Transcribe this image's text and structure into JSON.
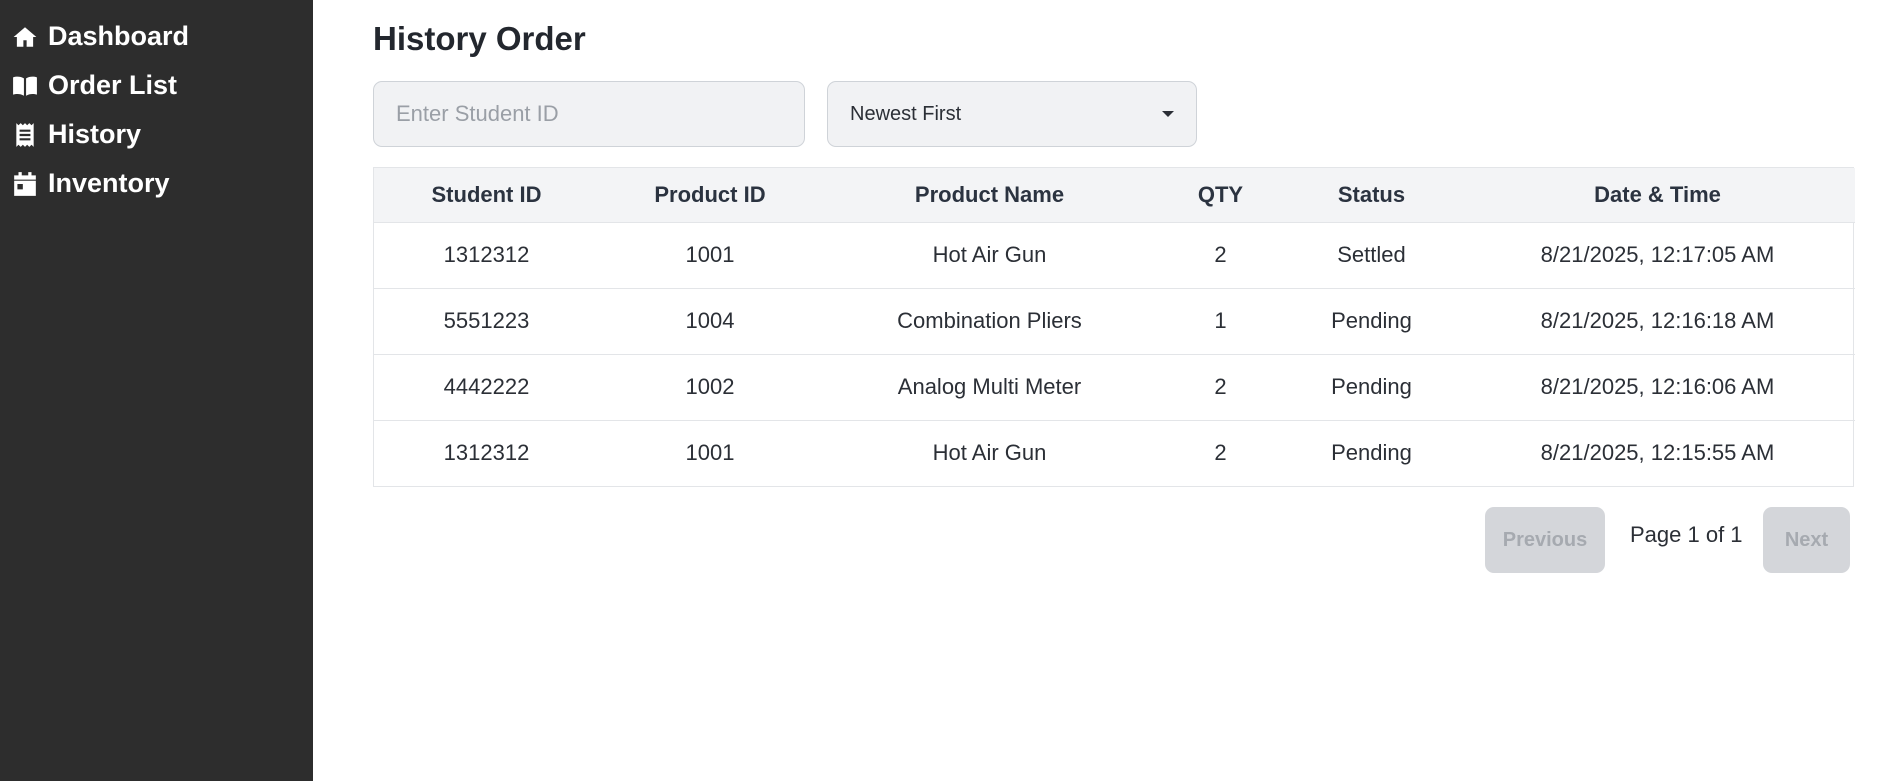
{
  "sidebar": {
    "items": [
      {
        "label": "Dashboard",
        "icon": "home-icon"
      },
      {
        "label": "Order List",
        "icon": "book-open-icon"
      },
      {
        "label": "History",
        "icon": "receipt-icon"
      },
      {
        "label": "Inventory",
        "icon": "calendar-icon"
      }
    ]
  },
  "page": {
    "title": "History Order"
  },
  "filters": {
    "search_placeholder": "Enter Student ID",
    "search_value": "",
    "sort_selected": "Newest First"
  },
  "table": {
    "headers": [
      "Student ID",
      "Product ID",
      "Product Name",
      "QTY",
      "Status",
      "Date & Time"
    ],
    "rows": [
      {
        "student_id": "1312312",
        "product_id": "1001",
        "product_name": "Hot Air Gun",
        "qty": "2",
        "status": "Settled",
        "datetime": "8/21/2025, 12:17:05 AM"
      },
      {
        "student_id": "5551223",
        "product_id": "1004",
        "product_name": "Combination Pliers",
        "qty": "1",
        "status": "Pending",
        "datetime": "8/21/2025, 12:16:18 AM"
      },
      {
        "student_id": "4442222",
        "product_id": "1002",
        "product_name": "Analog Multi Meter",
        "qty": "2",
        "status": "Pending",
        "datetime": "8/21/2025, 12:16:06 AM"
      },
      {
        "student_id": "1312312",
        "product_id": "1001",
        "product_name": "Hot Air Gun",
        "qty": "2",
        "status": "Pending",
        "datetime": "8/21/2025, 12:15:55 AM"
      }
    ]
  },
  "pagination": {
    "previous_label": "Previous",
    "page_info": "Page 1 of 1",
    "next_label": "Next"
  },
  "colors": {
    "sidebar_bg": "#2d2d2d",
    "header_bg": "#f3f4f6",
    "disabled_button": "#d4d6da"
  }
}
